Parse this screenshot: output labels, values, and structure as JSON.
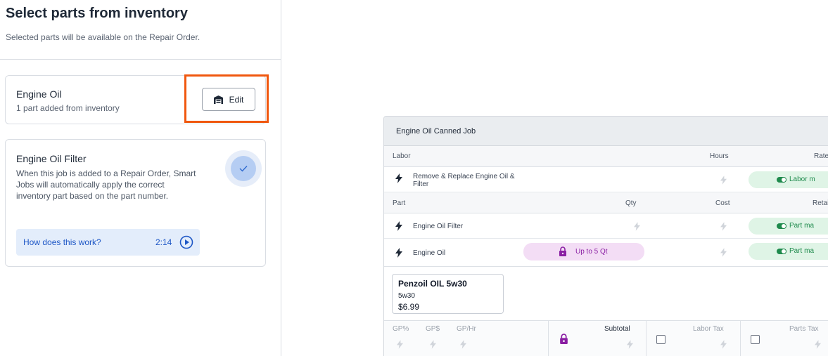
{
  "left_panel": {
    "title": "Select parts from inventory",
    "subtitle": "Selected parts will be available on the Repair Order.",
    "card_engine_oil": {
      "title": "Engine Oil",
      "subtitle": "1 part added from inventory",
      "edit_label": "Edit",
      "edit_icon": "garage-icon"
    },
    "card_engine_oil_filter": {
      "title": "Engine Oil Filter",
      "description": "When this job is added to a Repair Order, Smart Jobs will automatically apply the correct inventory part based on the part number.",
      "selected_icon": "check-icon",
      "help_link": "How does this work?",
      "help_duration": "2:14",
      "help_icon": "play-circle-icon"
    }
  },
  "canned_job": {
    "title": "Engine Oil Canned Job",
    "labor_header": {
      "labor": "Labor",
      "hours": "Hours",
      "rate": "Rate"
    },
    "labor_rows": [
      {
        "description": "Remove & Replace Engine Oil &",
        "description_line2": "Filter",
        "rate_pill": "Labor m"
      }
    ],
    "part_header": {
      "part": "Part",
      "qty": "Qty",
      "cost": "Cost",
      "retail": "Retail"
    },
    "part_rows": [
      {
        "name": "Engine Oil Filter",
        "retail_pill": "Part ma"
      },
      {
        "name": "Engine Oil",
        "qty_pill": "Up to 5 Qt",
        "retail_pill": "Part ma"
      }
    ],
    "selected_part": {
      "name": "Penzoil OIL 5w30",
      "spec": "5w30",
      "price": "$6.99"
    },
    "footer": {
      "gp_percent": "GP%",
      "gp_dollar": "GP$",
      "gp_hr": "GP/Hr",
      "subtotal": "Subtotal",
      "labor_tax": "Labor Tax",
      "parts_tax": "Parts Tax"
    },
    "colors": {
      "accent_orange": "#f0570e",
      "link_blue": "#1e57c6",
      "green": "#1e8a4c",
      "purple": "#8a1fa3"
    }
  }
}
